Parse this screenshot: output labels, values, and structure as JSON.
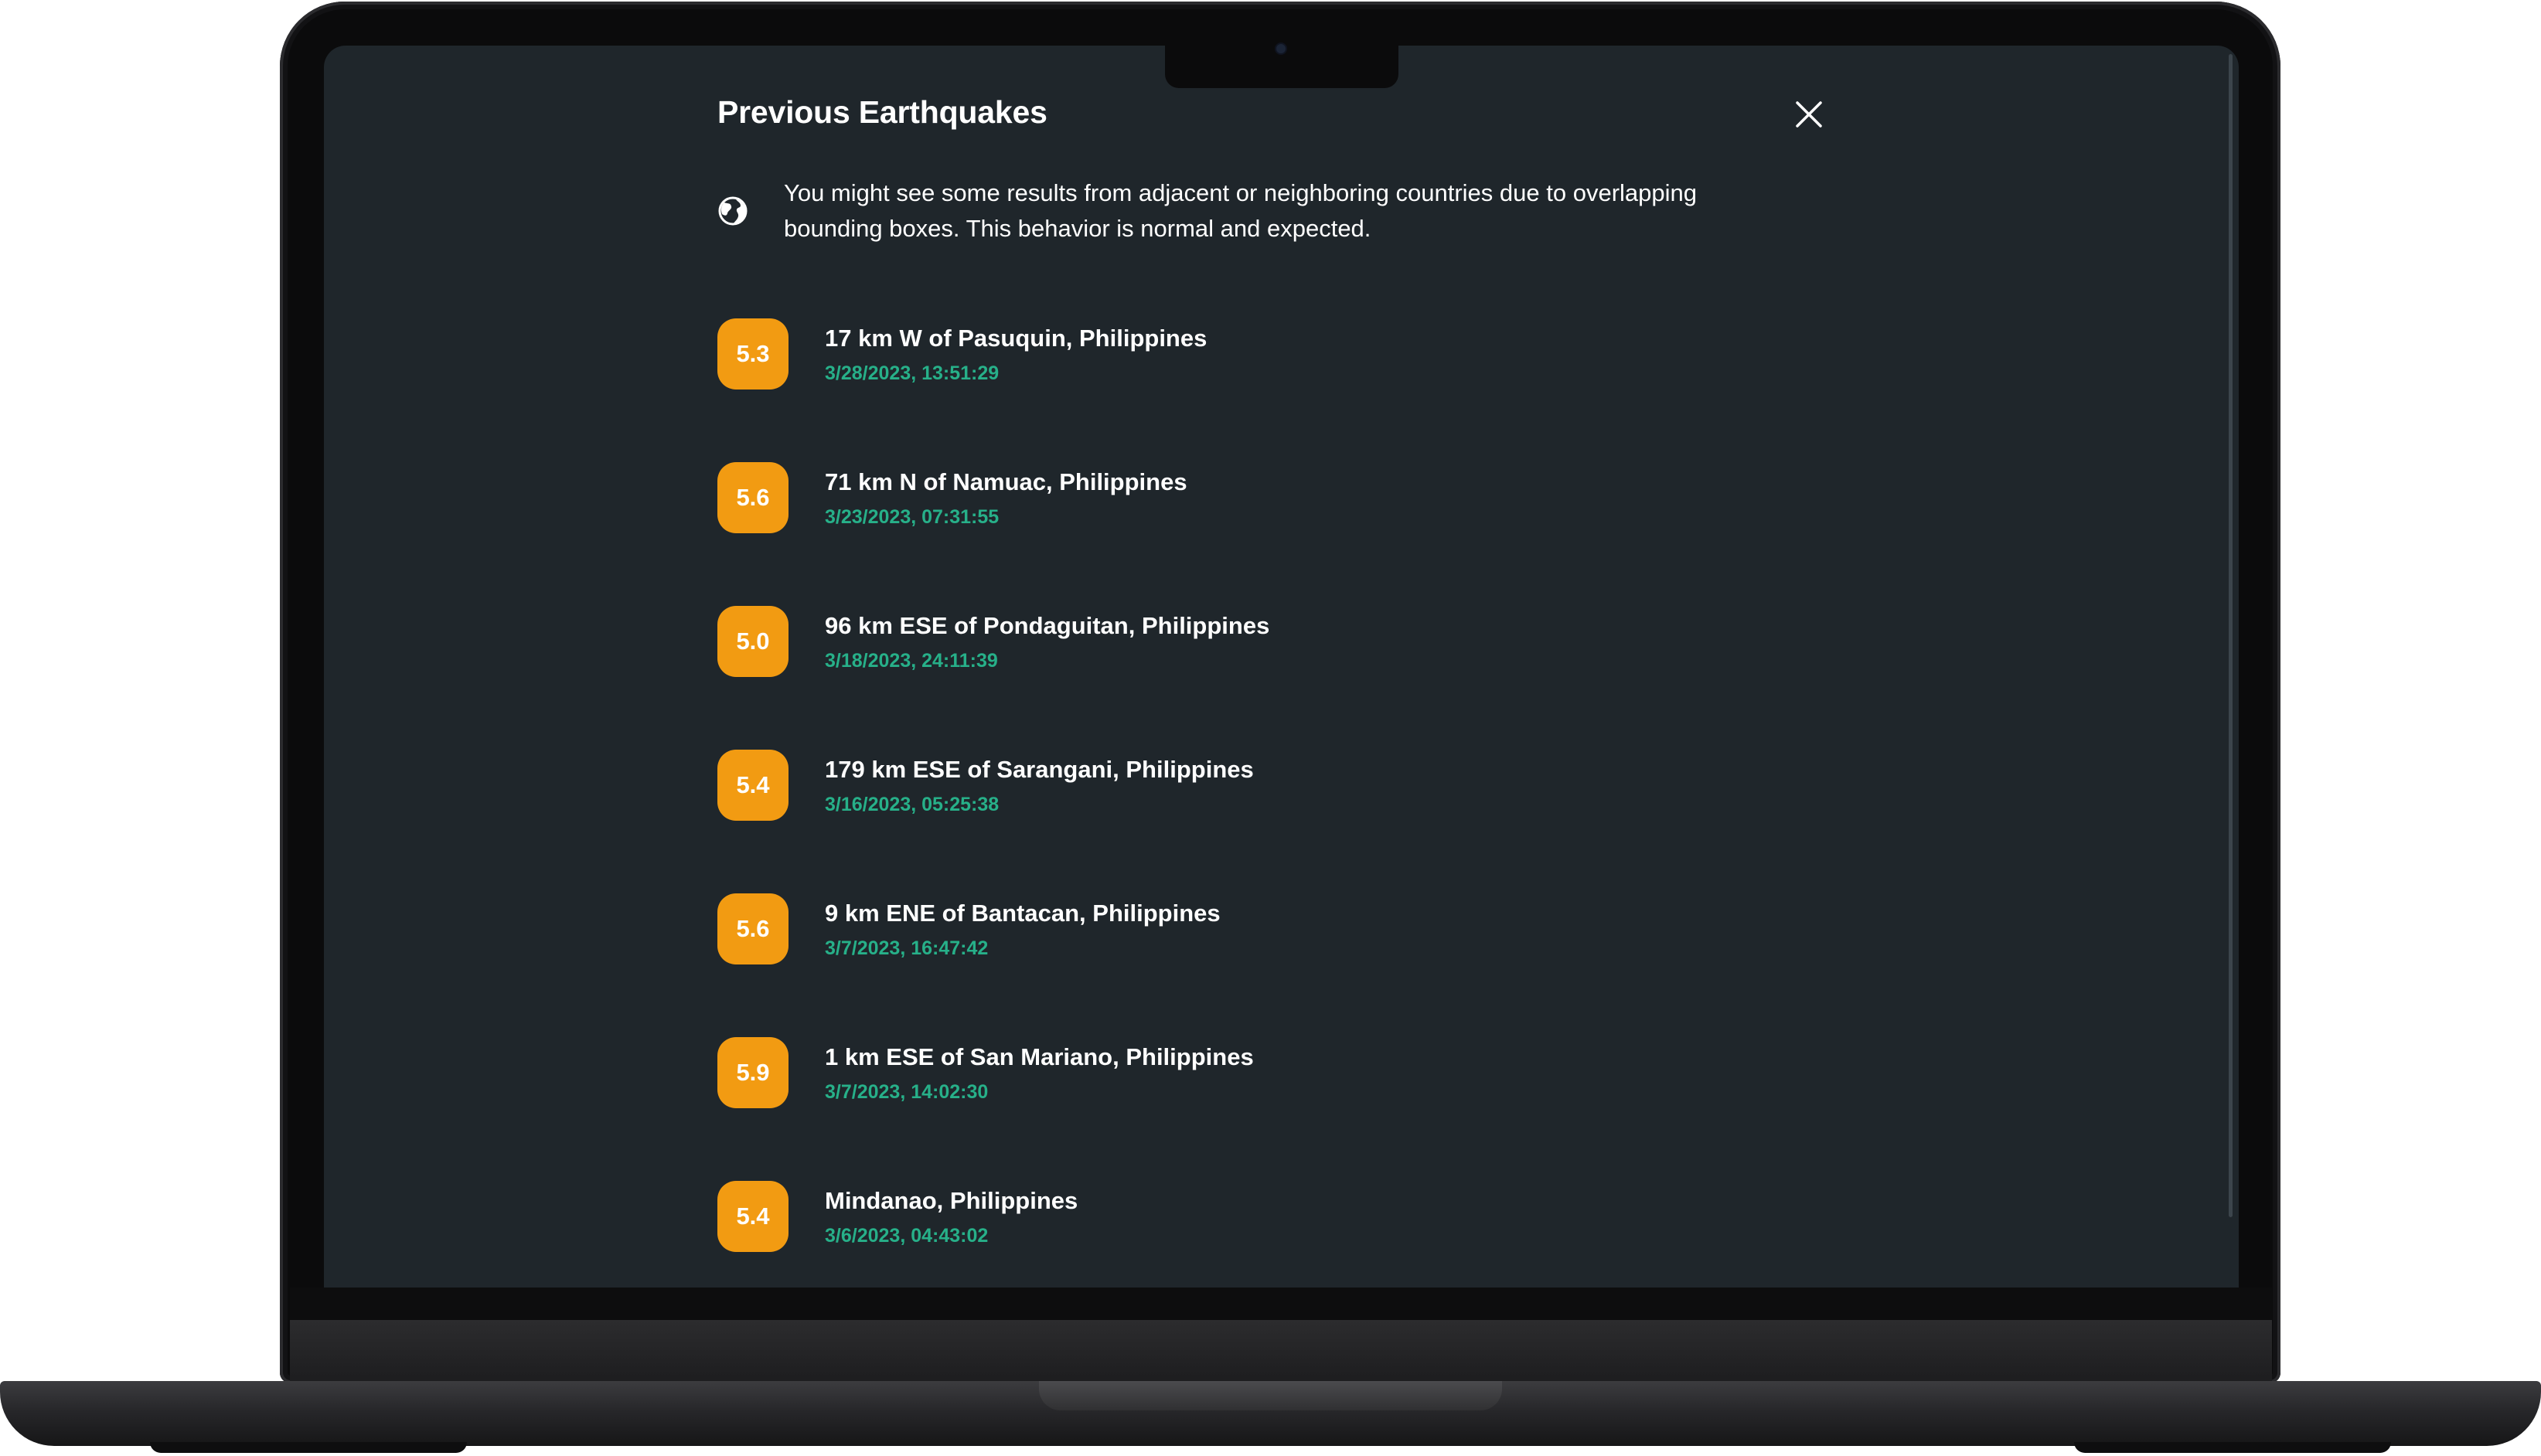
{
  "dialog": {
    "title": "Previous Earthquakes",
    "close_icon": "close-icon"
  },
  "notice": {
    "icon": "globe-icon",
    "text": "You might see some results from adjacent or neighboring countries due to overlapping bounding boxes. This behavior is normal and expected."
  },
  "earthquakes": [
    {
      "magnitude": "5.3",
      "place": "17 km W of Pasuquin, Philippines",
      "time": "3/28/2023, 13:51:29"
    },
    {
      "magnitude": "5.6",
      "place": "71 km N of Namuac, Philippines",
      "time": "3/23/2023, 07:31:55"
    },
    {
      "magnitude": "5.0",
      "place": "96 km ESE of Pondaguitan, Philippines",
      "time": "3/18/2023, 24:11:39"
    },
    {
      "magnitude": "5.4",
      "place": "179 km ESE of Sarangani, Philippines",
      "time": "3/16/2023, 05:25:38"
    },
    {
      "magnitude": "5.6",
      "place": "9 km ENE of Bantacan, Philippines",
      "time": "3/7/2023, 16:47:42"
    },
    {
      "magnitude": "5.9",
      "place": "1 km ESE of San Mariano, Philippines",
      "time": "3/7/2023, 14:02:30"
    },
    {
      "magnitude": "5.4",
      "place": "Mindanao, Philippines",
      "time": "3/6/2023, 04:43:02"
    }
  ],
  "colors": {
    "background": "#1f262b",
    "magnitude_badge": "#f29b12",
    "timestamp": "#27b089",
    "text": "#ffffff"
  }
}
